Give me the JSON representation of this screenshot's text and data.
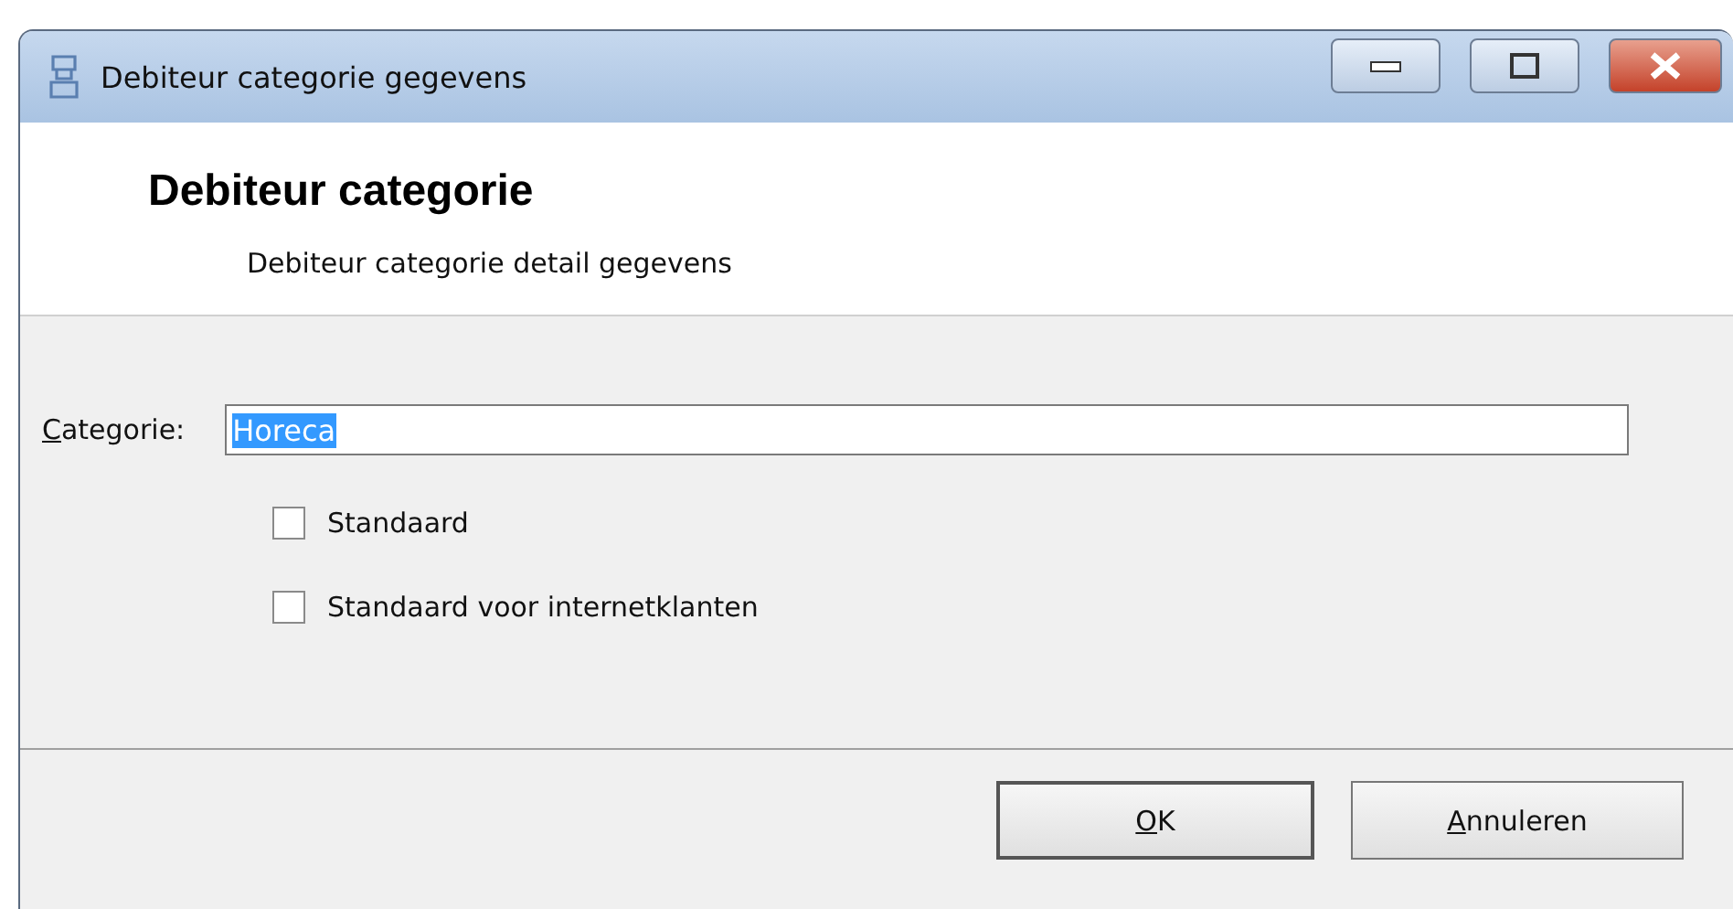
{
  "window": {
    "title": "Debiteur categorie gegevens"
  },
  "header": {
    "title": "Debiteur categorie",
    "subtitle": "Debiteur categorie detail gegevens"
  },
  "field": {
    "label": "Categorie:",
    "label_access_key": true,
    "value": "Horeca",
    "value_selected": true
  },
  "checkboxes": [
    {
      "label": "Standaard",
      "checked": false
    },
    {
      "label": "Standaard voor internetklanten",
      "checked": false
    }
  ],
  "buttons": [
    {
      "label": "OK",
      "access_key": true,
      "default": true
    },
    {
      "label": "Annuleren",
      "access_key": true,
      "default": false
    }
  ]
}
